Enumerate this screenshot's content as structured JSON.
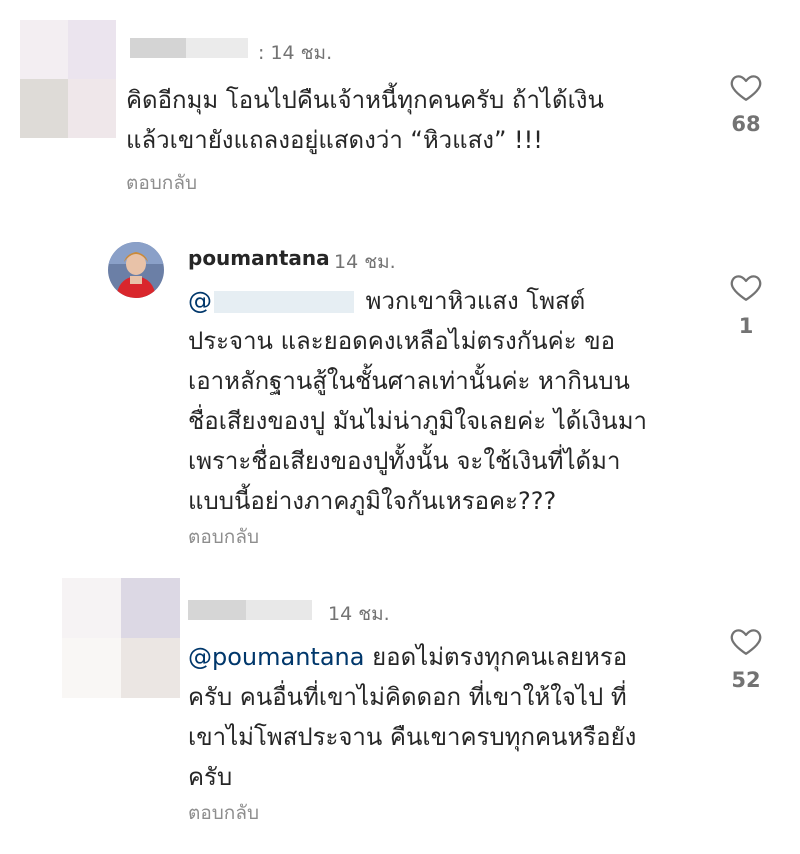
{
  "comments": [
    {
      "time": ": 14 ชม.",
      "lines": [
        "คิดอีกมุม โอนไปคืนเจ้าหนี้ทุกคนครับ ถ้าได้เงิน",
        "แล้วเขายังแถลงอยู่แสดงว่า “หิวแสง” !!!"
      ],
      "reply_label": "ตอบกลับ",
      "likes": "68"
    },
    {
      "username": "poumantana",
      "time": "14 ชม.",
      "mention_prefix": "@",
      "first_line_rest": " พวกเขาหิวแสง โพสต์",
      "lines": [
        "ประจาน และยอดคงเหลือไม่ตรงกันค่ะ ขอ",
        "เอาหลักฐานสู้ในชั้นศาลเท่านั้นค่ะ หากินบน",
        "ชื่อเสียงของปู มันไม่น่าภูมิใจเลยค่ะ ได้เงินมา",
        "เพราะชื่อเสียงของปูทั้งนั้น จะใช้เงินที่ได้มา",
        "แบบนี้อย่างภาคภูมิใจกันเหรอคะ???"
      ],
      "reply_label": "ตอบกลับ",
      "likes": "1"
    },
    {
      "time": "14 ชม.",
      "mention": "@poumantana",
      "first_line_rest": " ยอดไม่ตรงทุกคนเลยหรอ",
      "lines": [
        "ครับ คนอื่นที่เขาไม่คิดดอก ที่เขาให้ใจไป ที่",
        "เขาไม่โพสประจาน คืนเขาครบทุกคนหรือยัง",
        "ครับ"
      ],
      "reply_label": "ตอบกลับ",
      "likes": "52"
    }
  ],
  "icons": {
    "like": "heart-outline-icon"
  },
  "colors": {
    "text": "#262626",
    "muted": "#737373",
    "mention": "#00376b"
  }
}
